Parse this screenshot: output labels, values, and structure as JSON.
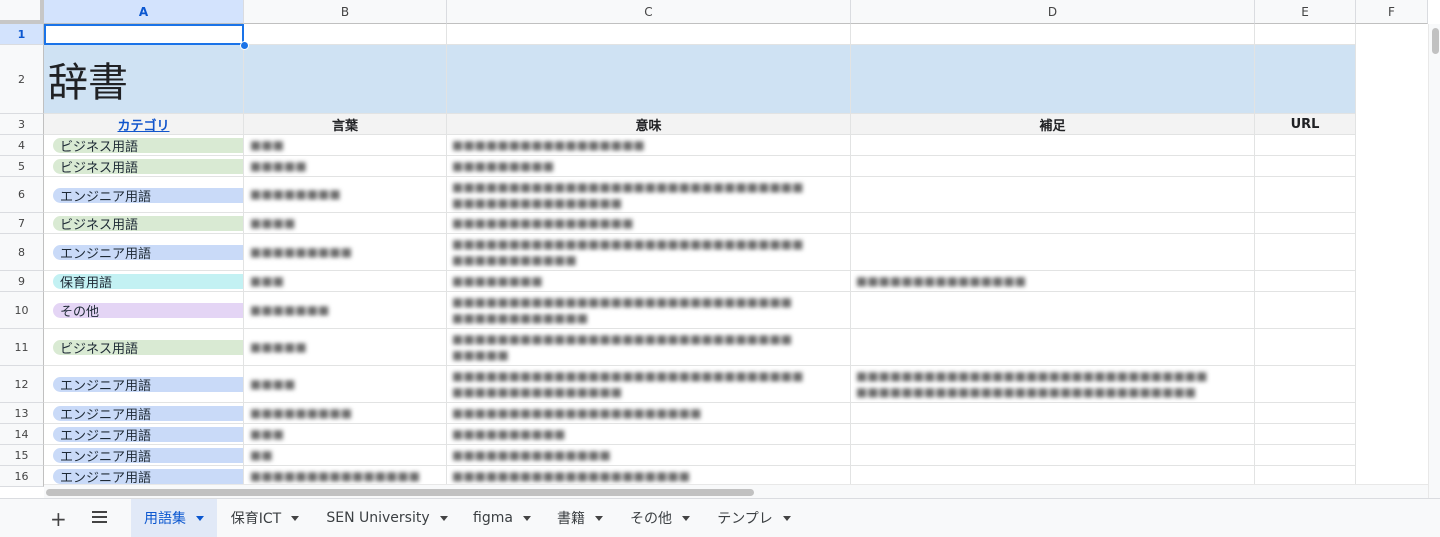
{
  "columns": [
    "A",
    "B",
    "C",
    "D",
    "E",
    "F"
  ],
  "rows": [
    "1",
    "2",
    "3",
    "4",
    "5",
    "6",
    "7",
    "8",
    "9",
    "10",
    "11",
    "12",
    "13",
    "14",
    "15",
    "16"
  ],
  "title": "辞書",
  "headers": {
    "category": "カテゴリ",
    "word": "言葉",
    "meaning": "意味",
    "note": "補足",
    "url": "URL"
  },
  "colors": {
    "business": "#d9ead3",
    "engineer": "#c9daf8",
    "childcare": "#c3f1f3",
    "other": "#e4d5f5",
    "header_blue": "#cfe2f3",
    "accent": "#0b57d0"
  },
  "categories": [
    {
      "label": "ビジネス用語",
      "type": "business"
    },
    {
      "label": "ビジネス用語",
      "type": "business"
    },
    {
      "label": "エンジニア用語",
      "type": "engineer"
    },
    {
      "label": "ビジネス用語",
      "type": "business"
    },
    {
      "label": "エンジニア用語",
      "type": "engineer"
    },
    {
      "label": "保育用語",
      "type": "childcare"
    },
    {
      "label": "その他",
      "type": "other"
    },
    {
      "label": "ビジネス用語",
      "type": "business"
    },
    {
      "label": "エンジニア用語",
      "type": "engineer"
    },
    {
      "label": "エンジニア用語",
      "type": "engineer"
    },
    {
      "label": "エンジニア用語",
      "type": "engineer"
    },
    {
      "label": "エンジニア用語",
      "type": "engineer"
    },
    {
      "label": "エンジニア用語",
      "type": "engineer"
    }
  ],
  "tabs": [
    "用語集",
    "保育ICT",
    "SEN University",
    "figma",
    "書籍",
    "その他",
    "テンプレ"
  ],
  "icons": {
    "add": "plus-icon",
    "all_sheets": "menu-icon"
  }
}
